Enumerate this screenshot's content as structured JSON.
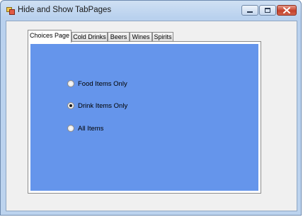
{
  "window": {
    "title": "Hide and Show TabPages"
  },
  "tabs": [
    {
      "label": "Choices Page",
      "active": true
    },
    {
      "label": "Cold Drinks",
      "active": false
    },
    {
      "label": "Beers",
      "active": false
    },
    {
      "label": "Wines",
      "active": false
    },
    {
      "label": "Spirits",
      "active": false
    }
  ],
  "choices": [
    {
      "label": "Food Items Only",
      "checked": false
    },
    {
      "label": "Drink Items Only",
      "checked": true
    },
    {
      "label": "All Items",
      "checked": false
    }
  ],
  "colors": {
    "page_background": "#6595eb",
    "close_button": "#c4402b"
  },
  "icons": {
    "app": "app-icon",
    "minimize": "minimize-icon",
    "maximize": "maximize-icon",
    "close": "close-icon"
  }
}
